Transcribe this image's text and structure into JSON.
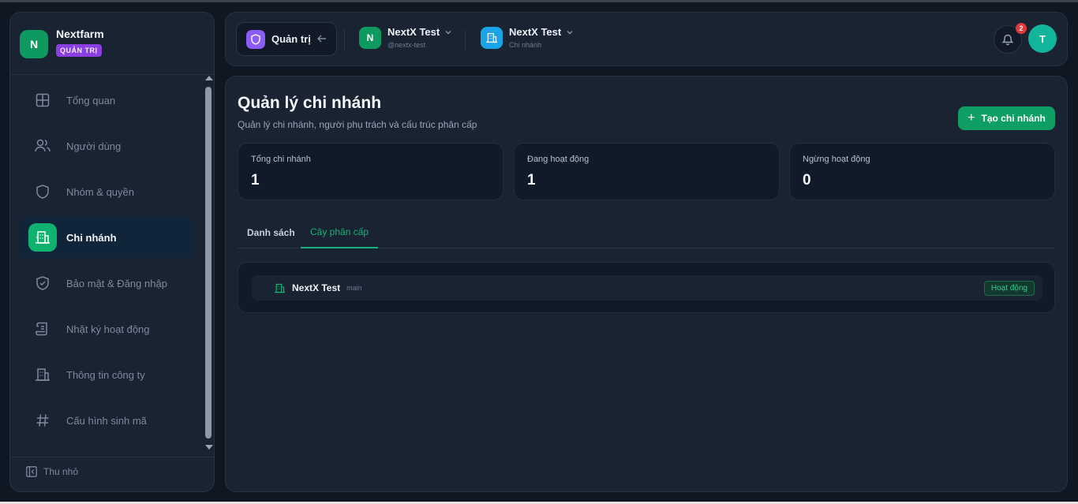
{
  "brand": {
    "name": "Nextfarm",
    "initial": "N",
    "badge": "QUẢN TRỊ"
  },
  "sidebar": {
    "items": [
      {
        "label": "Tổng quan",
        "icon": "grid-icon"
      },
      {
        "label": "Người dùng",
        "icon": "users-icon"
      },
      {
        "label": "Nhóm & quyền",
        "icon": "shield-icon"
      },
      {
        "label": "Chi nhánh",
        "icon": "building-icon",
        "active": true
      },
      {
        "label": "Bảo mật & Đăng nhập",
        "icon": "shield-check-icon"
      },
      {
        "label": "Nhật ký hoạt động",
        "icon": "scroll-icon"
      },
      {
        "label": "Thông tin công ty",
        "icon": "office-icon"
      },
      {
        "label": "Cấu hình sinh mã",
        "icon": "hash-icon"
      }
    ],
    "collapse_label": "Thu nhỏ"
  },
  "header": {
    "role_label": "Quản trị",
    "org": {
      "initial": "N",
      "name": "NextX Test",
      "handle": "@nextx-test"
    },
    "branch": {
      "name": "NextX Test",
      "sub": "Chi nhánh"
    },
    "notification_count": "2",
    "avatar_initial": "T"
  },
  "page": {
    "title": "Quản lý chi nhánh",
    "subtitle": "Quản lý chi nhánh, người phụ trách và cấu trúc phân cấp",
    "create_button": "Tạo chi nhánh",
    "stats": [
      {
        "label": "Tổng chi nhánh",
        "value": "1"
      },
      {
        "label": "Đang hoạt động",
        "value": "1"
      },
      {
        "label": "Ngừng hoạt động",
        "value": "0"
      }
    ],
    "tabs": [
      "Danh sách",
      "Cây phân cấp"
    ],
    "active_tab": "Cây phân cấp",
    "tree": [
      {
        "name": "NextX Test",
        "code": "main",
        "status": "Hoạt động"
      }
    ]
  },
  "colors": {
    "accent_green": "#0f9e64",
    "purple": "#8b5cf6",
    "badge_red": "#e5383b"
  }
}
